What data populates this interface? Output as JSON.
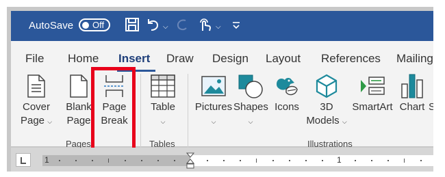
{
  "titlebar": {
    "autosave_label": "AutoSave",
    "toggle_state": "Off",
    "quick_access_icons": [
      "save-icon",
      "undo-icon",
      "redo-icon",
      "touch-mode-icon",
      "customize-quick-access-icon"
    ]
  },
  "tabs": [
    "File",
    "Home",
    "Insert",
    "Draw",
    "Design",
    "Layout",
    "References",
    "Mailing"
  ],
  "active_tab": "Insert",
  "groups": {
    "pages": {
      "label": "Pages",
      "buttons": {
        "cover_page": {
          "line1": "Cover",
          "line2": "Page",
          "icon": "cover-page-icon"
        },
        "blank_page": {
          "line1": "Blank",
          "line2": "Page",
          "icon": "blank-page-icon"
        },
        "page_break": {
          "line1": "Page",
          "line2": "Break",
          "icon": "page-break-icon"
        }
      }
    },
    "tables": {
      "label": "Tables",
      "buttons": {
        "table": {
          "line1": "Table",
          "icon": "table-grid-icon"
        }
      }
    },
    "illustrations": {
      "label": "Illustrations",
      "buttons": {
        "pictures": {
          "line1": "Pictures",
          "icon": "pictures-icon"
        },
        "shapes": {
          "line1": "Shapes",
          "icon": "shapes-icon"
        },
        "icons": {
          "line1": "Icons",
          "icon": "icons-icon"
        },
        "models3d": {
          "line1": "3D",
          "line2": "Models",
          "icon": "3d-models-icon"
        },
        "smartart": {
          "line1": "SmartArt",
          "icon": "smartart-icon"
        },
        "chart": {
          "line1": "Chart",
          "icon": "chart-icon"
        },
        "screenshot_partial": {
          "line1": "S"
        }
      }
    }
  },
  "ruler": {
    "labels": [
      "1",
      "1"
    ]
  },
  "colors": {
    "titlebar": "#2b579a",
    "ribbon": "#f3f3f3",
    "highlight": "#e8001b",
    "accent_blue": "#2b579a",
    "icon_teal": "#1e8a9c",
    "icon_green": "#2e9a46"
  }
}
